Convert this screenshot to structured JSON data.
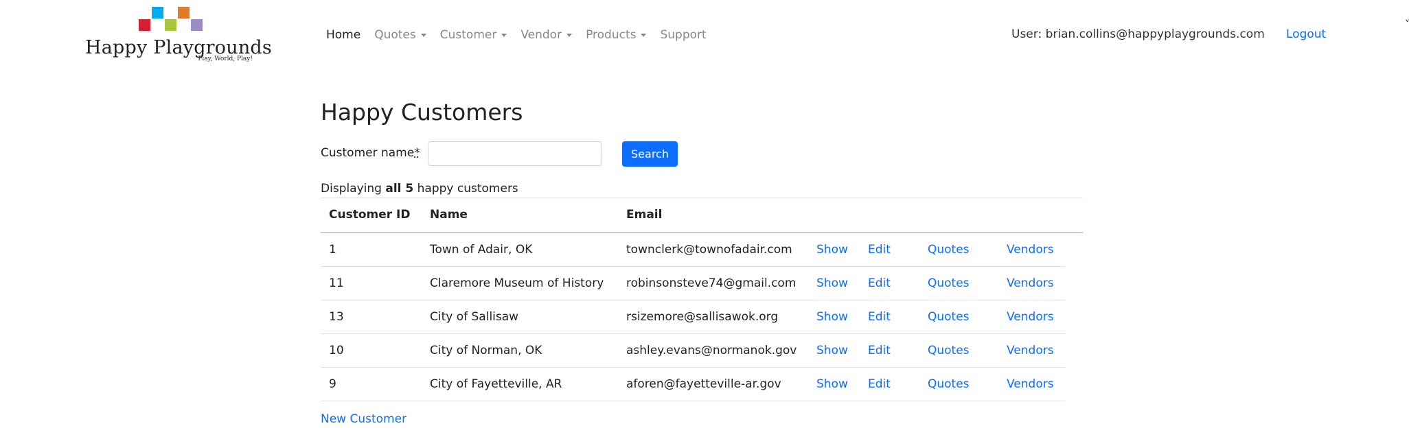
{
  "brand": {
    "name": "Happy Playgrounds",
    "tagline": "Play, World, Play!",
    "block_colors": [
      "#00aeef",
      "#e07b27",
      "#d42031",
      "#a8c73e",
      "#9c8cc4"
    ]
  },
  "nav": {
    "items": [
      {
        "label": "Home",
        "dropdown": false,
        "active": true
      },
      {
        "label": "Quotes",
        "dropdown": true,
        "active": false
      },
      {
        "label": "Customer",
        "dropdown": true,
        "active": false
      },
      {
        "label": "Vendor",
        "dropdown": true,
        "active": false
      },
      {
        "label": "Products",
        "dropdown": true,
        "active": false
      },
      {
        "label": "Support",
        "dropdown": false,
        "active": false
      }
    ],
    "user_label": "User: brian.collins@happyplaygrounds.com",
    "logout_label": "Logout"
  },
  "main": {
    "title": "Happy Customers",
    "search": {
      "label": "Customer name",
      "required_mark": "*",
      "value": "",
      "placeholder": "",
      "button_label": "Search"
    },
    "summary": {
      "prefix": "Displaying",
      "bold": "all 5",
      "suffix": "happy customers"
    },
    "table": {
      "headers": {
        "id": "Customer ID",
        "name": "Name",
        "email": "Email"
      },
      "action_labels": {
        "show": "Show",
        "edit": "Edit",
        "quotes": "Quotes",
        "vendors": "Vendors"
      },
      "rows": [
        {
          "id": "1",
          "name": "Town of Adair, OK",
          "email": "townclerk@townofadair.com"
        },
        {
          "id": "11",
          "name": "Claremore Museum of History",
          "email": "robinsonsteve74@gmail.com"
        },
        {
          "id": "13",
          "name": "City of Sallisaw",
          "email": "rsizemore@sallisawok.org"
        },
        {
          "id": "10",
          "name": "City of Norman, OK",
          "email": "ashley.evans@normanok.gov"
        },
        {
          "id": "9",
          "name": "City of Fayetteville, AR",
          "email": "aforen@fayetteville-ar.gov"
        }
      ]
    },
    "new_customer_label": "New Customer"
  },
  "colors": {
    "link": "#0d6efd",
    "primary_button": "#0d6efd",
    "nav_inactive": "#888888"
  }
}
